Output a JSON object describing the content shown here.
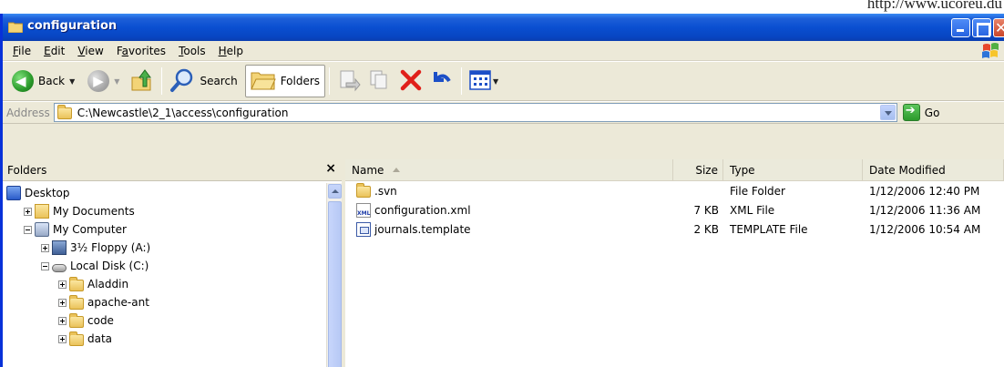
{
  "watermark": "http://www.ucoreu.du",
  "window": {
    "title": "configuration"
  },
  "menu": [
    {
      "label": "File",
      "ul": "F",
      "rest": "ile"
    },
    {
      "label": "Edit",
      "ul": "E",
      "rest": "dit"
    },
    {
      "label": "View",
      "ul": "V",
      "rest": "iew"
    },
    {
      "label": "Favorites",
      "ul": "a",
      "pre": "F",
      "rest": "vorites"
    },
    {
      "label": "Tools",
      "ul": "T",
      "rest": "ools"
    },
    {
      "label": "Help",
      "ul": "H",
      "rest": "elp"
    }
  ],
  "toolbar": {
    "back_label": "Back",
    "search_label": "Search",
    "folders_label": "Folders"
  },
  "address": {
    "label": "Address",
    "value": "C:\\Newcastle\\2_1\\access\\configuration",
    "go_label": "Go"
  },
  "folders_pane": {
    "title": "Folders",
    "close_glyph": "×",
    "tree": [
      {
        "label": "Desktop",
        "indent": 0,
        "toggle": "none",
        "icon": "desktop"
      },
      {
        "label": "My Documents",
        "indent": 1,
        "toggle": "plus",
        "icon": "mydocs"
      },
      {
        "label": "My Computer",
        "indent": 1,
        "toggle": "minus",
        "icon": "computer"
      },
      {
        "label": "3½ Floppy (A:)",
        "indent": 2,
        "toggle": "plus",
        "icon": "floppy"
      },
      {
        "label": "Local Disk (C:)",
        "indent": 2,
        "toggle": "minus",
        "icon": "disk"
      },
      {
        "label": "Aladdin",
        "indent": 3,
        "toggle": "plus",
        "icon": "folder"
      },
      {
        "label": "apache-ant",
        "indent": 3,
        "toggle": "plus",
        "icon": "folder"
      },
      {
        "label": "code",
        "indent": 3,
        "toggle": "plus",
        "icon": "folder"
      },
      {
        "label": "data",
        "indent": 3,
        "toggle": "plus",
        "icon": "folder"
      }
    ]
  },
  "columns": {
    "name": "Name",
    "size": "Size",
    "type": "Type",
    "date": "Date Modified"
  },
  "files": [
    {
      "name": ".svn",
      "size": "",
      "type": "File Folder",
      "date": "1/12/2006 12:40 PM",
      "icon": "folder"
    },
    {
      "name": "configuration.xml",
      "size": "7 KB",
      "type": "XML File",
      "date": "1/12/2006 11:36 AM",
      "icon": "xml"
    },
    {
      "name": "journals.template",
      "size": "2 KB",
      "type": "TEMPLATE File",
      "date": "1/12/2006 10:54 AM",
      "icon": "template"
    }
  ]
}
